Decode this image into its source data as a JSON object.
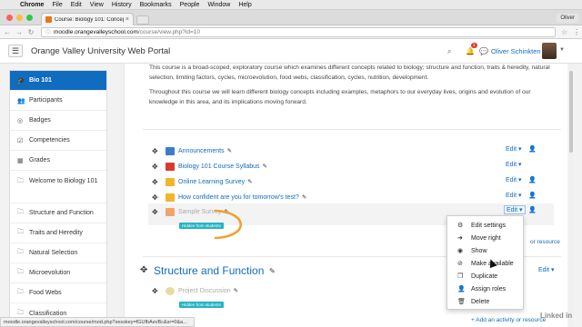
{
  "os_menubar": {
    "app": "Chrome",
    "items": [
      "File",
      "Edit",
      "View",
      "History",
      "Bookmarks",
      "People",
      "Window",
      "Help"
    ]
  },
  "browser": {
    "tab_title": "Course: Biology 101: Concep",
    "profile": "Oliver",
    "url_host": "moodle.orangevalleyschool.com",
    "url_path": "/course/view.php?id=10",
    "status_url": "moodle.orangevalleyschool.com/course/mod.php?sesskey=fGUfbAevBc&sr=0&a..."
  },
  "navbar": {
    "site_name": "Orange Valley University Web Portal",
    "notification_count": "1",
    "user_name": "Oliver Schinkten"
  },
  "sidebar": {
    "items": [
      {
        "label": "Bio 101",
        "icon": "graduation-cap-icon"
      },
      {
        "label": "Participants",
        "icon": "users-icon"
      },
      {
        "label": "Badges",
        "icon": "badge-icon"
      },
      {
        "label": "Competencies",
        "icon": "check-square-icon"
      },
      {
        "label": "Grades",
        "icon": "table-icon"
      },
      {
        "label": "Welcome to Biology 101",
        "icon": "folder-icon"
      },
      {
        "label": "Structure and Function",
        "icon": "folder-icon"
      },
      {
        "label": "Traits and Heredity",
        "icon": "folder-icon"
      },
      {
        "label": "Natural Selection",
        "icon": "folder-icon"
      },
      {
        "label": "Microevolution",
        "icon": "folder-icon"
      },
      {
        "label": "Food Webs",
        "icon": "folder-icon"
      },
      {
        "label": "Classification",
        "icon": "folder-icon"
      }
    ]
  },
  "main": {
    "intro_p1": "This course is a broad-scoped, exploratory course which examines different concepts related to biology; structure and function, traits & heredity, natural selection, limiting factors, cycles, microevolution, food webs, classification, cycles, nutrition, development.",
    "intro_p2": "Throughout this course we will learn different biology concepts including examples, metaphors to our everyday lives, origins and evolution of our knowledge in this area, and its implications moving forward.",
    "activities": [
      {
        "name": "Announcements",
        "icon_color": "#3d7cc9",
        "hidden": false
      },
      {
        "name": "Biology 101 Course Syllabus",
        "icon_color": "#d83b2b",
        "hidden": false
      },
      {
        "name": "Online Learning Survey",
        "icon_color": "#f2b52a",
        "hidden": false
      },
      {
        "name": "How confident are you for tomorrow's test?",
        "icon_color": "#f2b52a",
        "hidden": false
      },
      {
        "name": "Sample Survey",
        "icon_color": "#f0a46a",
        "hidden": true
      }
    ],
    "hidden_badge": "Hidden from students",
    "edit_label": "Edit",
    "section_title": "Structure and Function",
    "section_activity": "Project Discussion",
    "add_activity": "+ Add an activity or resource",
    "add_activity_partial": "or resource"
  },
  "dropdown": {
    "items": [
      {
        "label": "Edit settings",
        "icon": "gear-icon"
      },
      {
        "label": "Move right",
        "icon": "arrow-right-icon"
      },
      {
        "label": "Show",
        "icon": "eye-icon"
      },
      {
        "label": "Make available",
        "icon": "ban-icon"
      },
      {
        "label": "Duplicate",
        "icon": "copy-icon"
      },
      {
        "label": "Assign roles",
        "icon": "user-icon"
      },
      {
        "label": "Delete",
        "icon": "trash-icon"
      }
    ]
  },
  "watermark": "Linked in"
}
